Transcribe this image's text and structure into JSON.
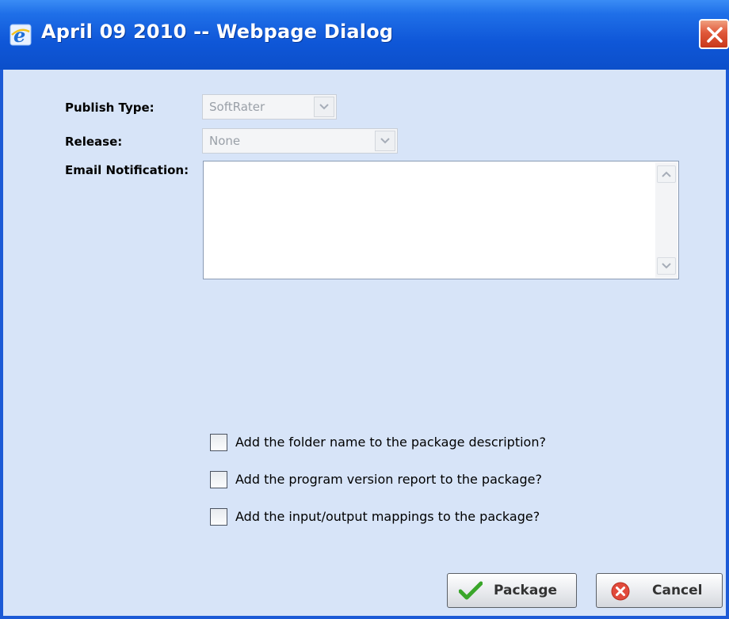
{
  "window": {
    "title": "April 09 2010 -- Webpage Dialog",
    "title_icon": "ie-icon",
    "close_icon": "close-icon",
    "accent_color": "#0c4fca",
    "close_color": "#e0583a"
  },
  "form": {
    "publish_type_label": "Publish Type:",
    "publish_type_value": "SoftRater",
    "release_label": "Release:",
    "release_value": "None",
    "email_label": "Email Notification:",
    "email_value": ""
  },
  "options": [
    {
      "label": "Add the folder name to the package description?",
      "checked": false
    },
    {
      "label": "Add the program version report to the package?",
      "checked": false
    },
    {
      "label": "Add the input/output mappings to the package?",
      "checked": false
    }
  ],
  "buttons": {
    "package_label": "Package",
    "package_icon": "check-icon",
    "cancel_label": "Cancel",
    "cancel_icon": "cancel-icon"
  }
}
